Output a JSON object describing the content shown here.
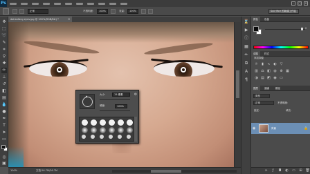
{
  "app": {
    "logo": "Ps"
  },
  "window_controls": [
    "–",
    "□",
    "✕"
  ],
  "options_bar": {
    "mode_value": "正常",
    "opacity_label": "不透明度:",
    "opacity_value": "100%",
    "flow_label": "流量:",
    "flow_value": "100%",
    "workspace": "Sacrifice 的新建工作区"
  },
  "document": {
    "tab_title": "dahanfang eyes.jpg @ 100%(RGB/8#) *",
    "close": "×"
  },
  "brush_picker": {
    "size_label": "大小:",
    "size_value": "15 像素",
    "hardness_label": "硬度:",
    "hardness_value": "100%"
  },
  "color_panel": {
    "tabs": [
      "颜色",
      "色板"
    ],
    "value": "0"
  },
  "adjustments_panel": {
    "tabs": [
      "调整",
      "样式"
    ],
    "title": "添加调整"
  },
  "layers_panel": {
    "tabs": [
      "图层",
      "通道",
      "路径"
    ],
    "kind_label": "类型",
    "blend_mode": "正常",
    "opacity_label": "不透明度:",
    "lock_label": "锁定:",
    "fill_label": "填充:",
    "layer_name": "背景"
  },
  "status_bar": {
    "zoom": "100%",
    "doc_info": "文档:26.7M/26.7M"
  },
  "colors": {
    "accent_layer": "#6c8fb5",
    "eye_highlight": "#ffffff"
  }
}
